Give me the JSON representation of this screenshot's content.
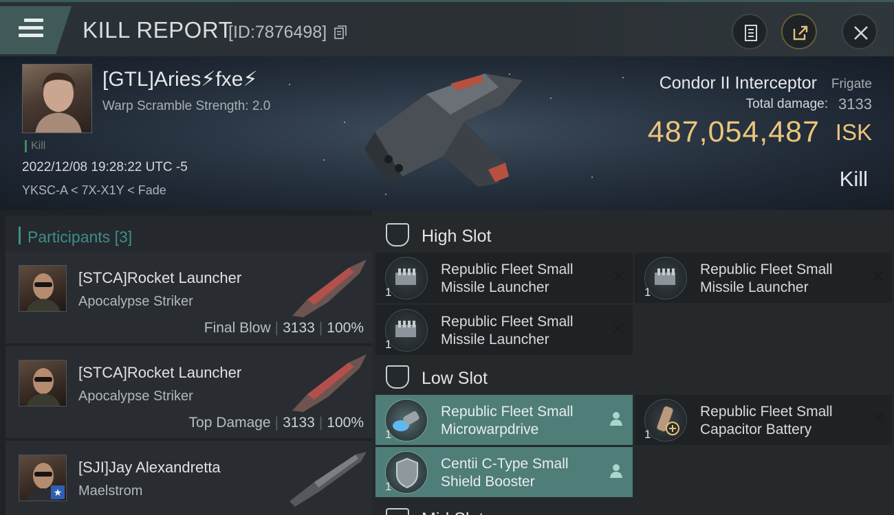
{
  "header": {
    "title": "KILL REPORT",
    "report_id": "[ID:7876498]",
    "icons": [
      "menu-icon",
      "copy-icon",
      "report-icon",
      "share-icon",
      "close-icon"
    ]
  },
  "victim": {
    "pilot": "[GTL]Aries⚡fxe⚡",
    "warp_scramble": "Warp Scramble Strength: 2.0",
    "tag": "Kill",
    "datetime": "2022/12/08 19:28:22 UTC -5",
    "location": "YKSC-A < 7X-X1Y < Fade",
    "ship_name": "Condor II Interceptor",
    "ship_class": "Frigate",
    "total_damage_label": "Total damage:",
    "total_damage": "3133",
    "isk_value": "487,054,487",
    "isk_unit": "ISK",
    "result": "Kill"
  },
  "participants": {
    "title": "Participants",
    "count": "[3]",
    "items": [
      {
        "name": "[STCA]Rocket Launcher",
        "ship": "Apocalypse Striker",
        "label": "Final Blow",
        "damage": "3133",
        "percent": "100%"
      },
      {
        "name": "[STCA]Rocket Launcher",
        "ship": "Apocalypse Striker",
        "label": "Top Damage",
        "damage": "3133",
        "percent": "100%"
      },
      {
        "name": "[SJI]Jay Alexandretta",
        "ship": "Maelstrom"
      }
    ]
  },
  "fitting": {
    "high_slot": {
      "title": "High Slot",
      "modules": [
        {
          "qty": "1",
          "name": "Republic Fleet Small\nMissile Launcher",
          "status": "destroyed"
        },
        {
          "qty": "1",
          "name": "Republic Fleet Small\nMissile Launcher",
          "status": "destroyed"
        },
        {
          "qty": "1",
          "name": "Republic Fleet Small\nMissile Launcher",
          "status": "destroyed"
        }
      ]
    },
    "low_slot": {
      "title": "Low Slot",
      "modules": [
        {
          "qty": "1",
          "name": "Republic Fleet Small\nMicrowarpdrive",
          "status": "dropped"
        },
        {
          "qty": "1",
          "name": "Republic Fleet Small\nCapacitor Battery",
          "status": "destroyed"
        },
        {
          "qty": "1",
          "name": "Centii C-Type Small\nShield Booster",
          "status": "dropped"
        }
      ]
    },
    "next_slot_partial": "Mid Slot"
  },
  "colors": {
    "accent": "#3d8e8b",
    "isk": "#ebc57a",
    "dropped": "#4f7d78"
  }
}
